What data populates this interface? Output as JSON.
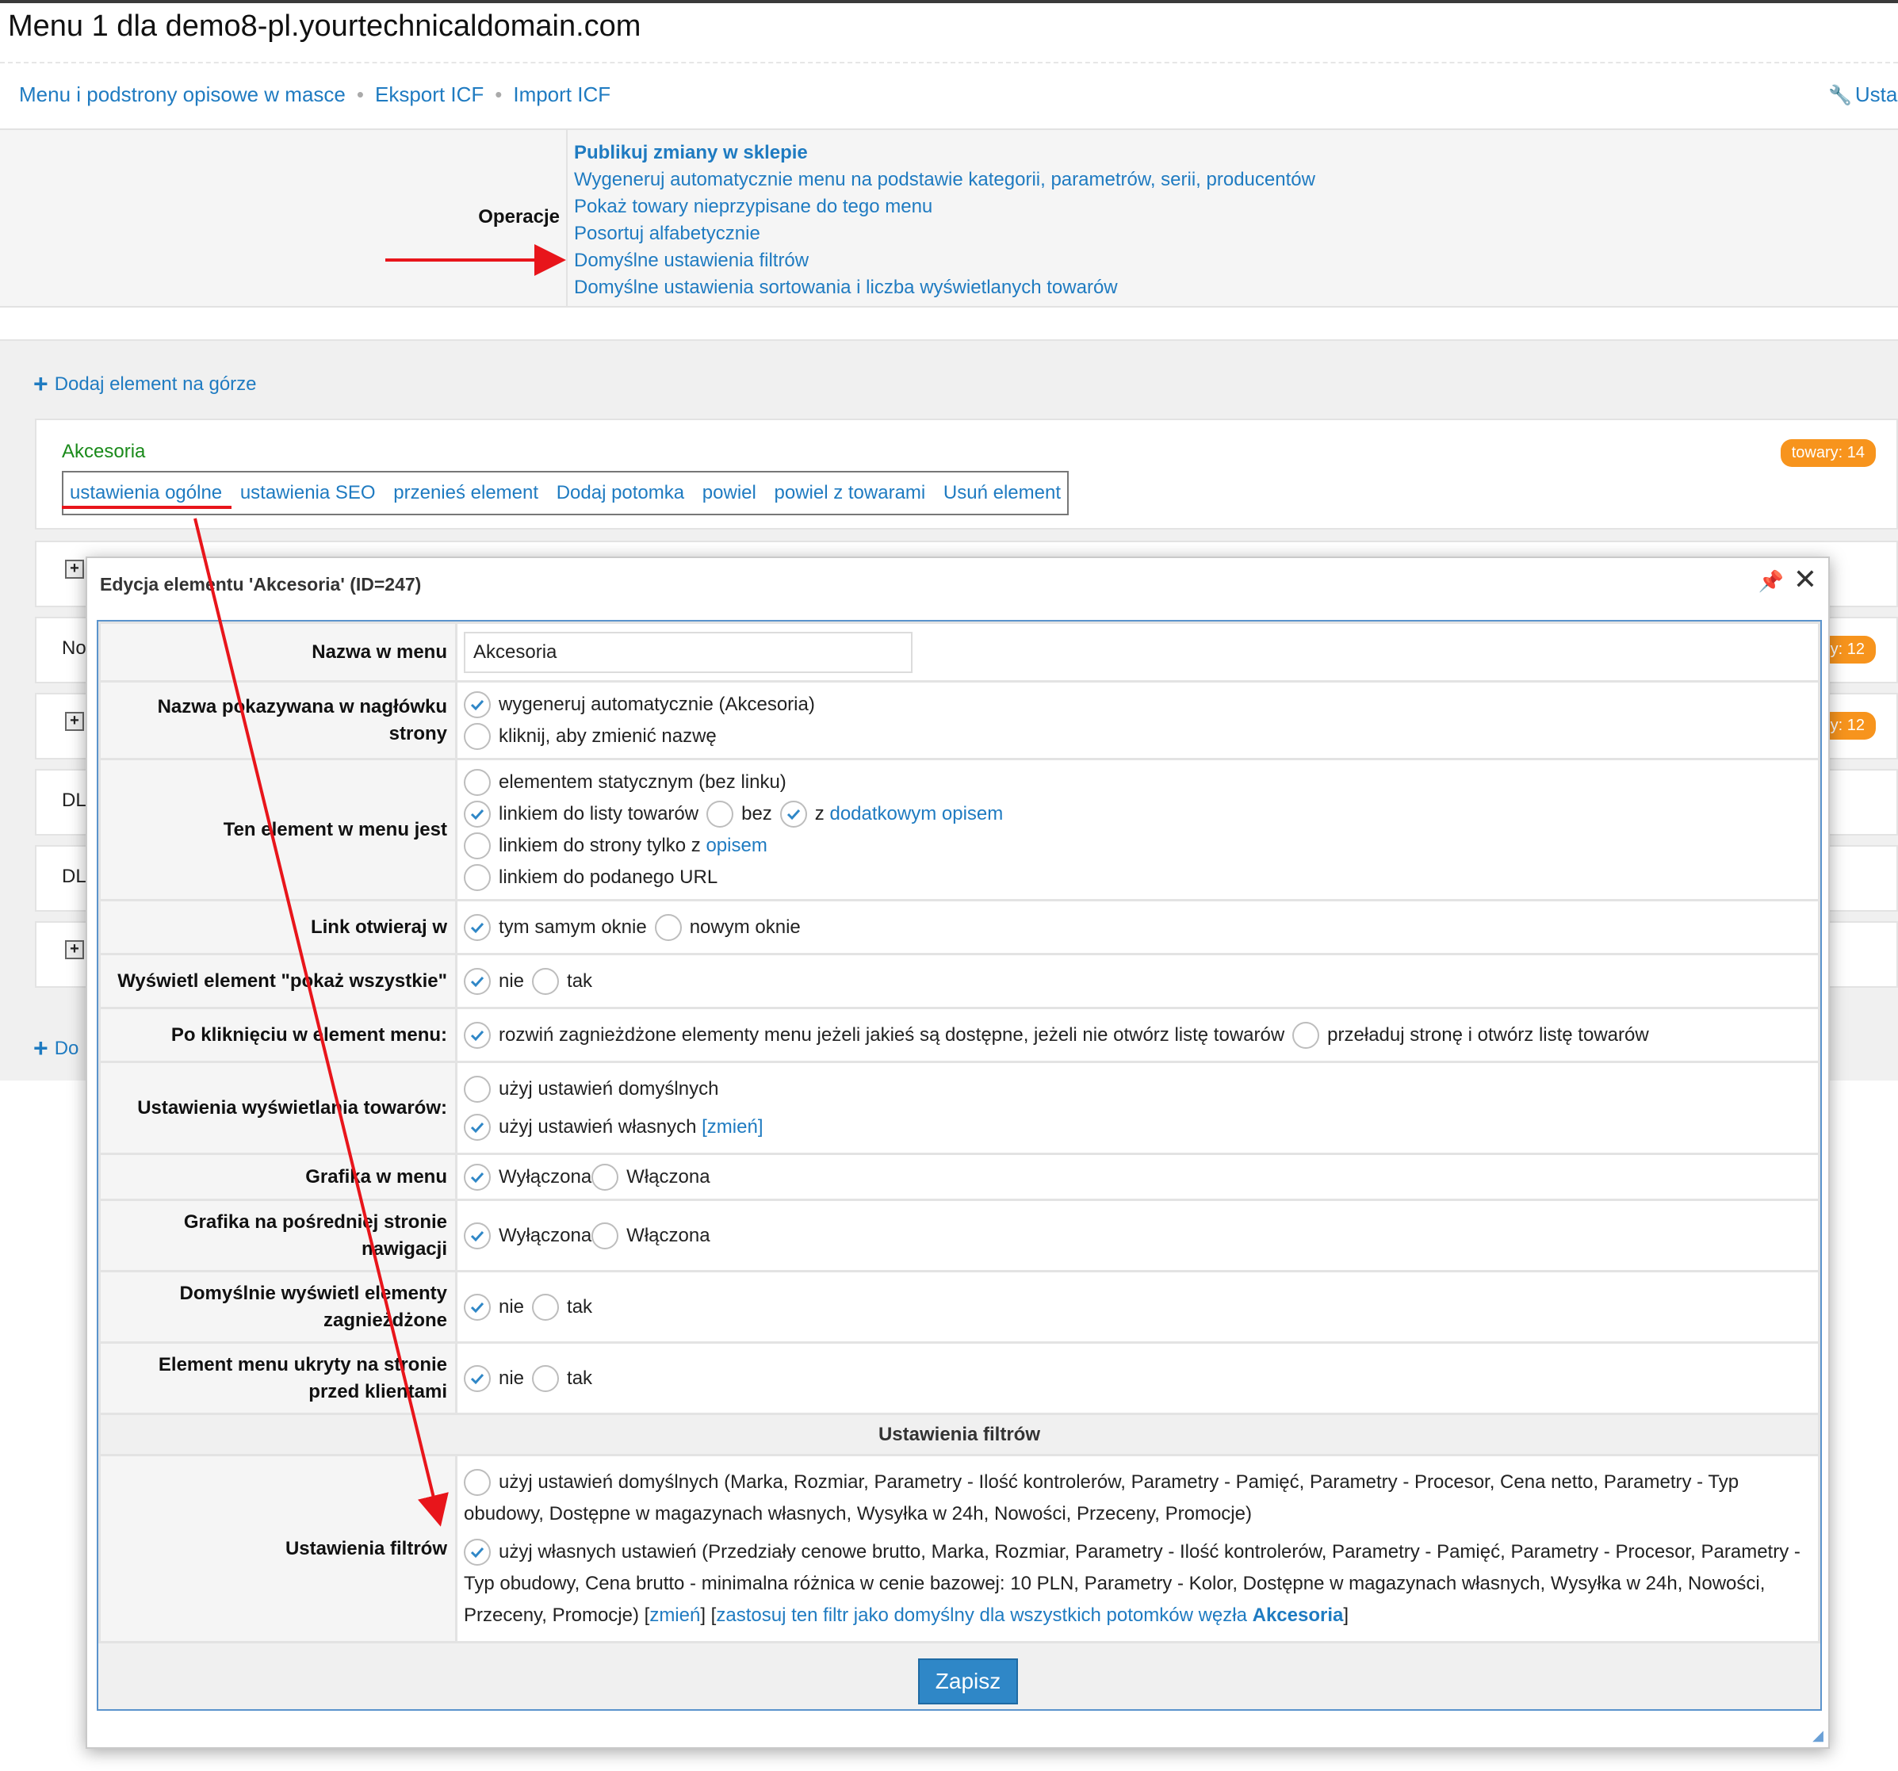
{
  "page": {
    "title": "Menu 1 dla demo8-pl.yourtechnicaldomain.com",
    "nav": [
      "Menu i podstrony opisowe w masce",
      "Eksport ICF",
      "Import ICF"
    ],
    "settings_link": "Usta"
  },
  "operations": {
    "label": "Operacje",
    "items": [
      "Publikuj zmiany w sklepie",
      "Wygeneruj automatycznie menu na podstawie kategorii, parametrów, serii, producentów",
      "Pokaż towary nieprzypisane do tego menu",
      "Posortuj alfabetycznie",
      "Domyślne ustawienia filtrów",
      "Domyślne ustawienia sortowania i liczba wyświetlanych towarów"
    ]
  },
  "add_top": "Dodaj element na górze",
  "add_bottom": "Do",
  "item": {
    "name": "Akcesoria",
    "badge": "towary: 14",
    "actions": [
      "ustawienia ogólne",
      "ustawienia SEO",
      "przenieś element",
      "Dodaj potomka",
      "powiel",
      "powiel z towarami",
      "Usuń element"
    ]
  },
  "background_rows": {
    "row2_text": "No",
    "row2_badge": "y: 12",
    "row3_badge": "y: 12",
    "row4_text": "DL",
    "row5_text": "DL"
  },
  "modal": {
    "title": "Edycja elementu 'Akcesoria' (ID=247)",
    "rows": {
      "name_label": "Nazwa w menu",
      "name_value": "Akcesoria",
      "header_label": "Nazwa pokazywana w nagłówku strony",
      "header_opt1": "wygeneruj automatycznie (Akcesoria)",
      "header_opt2": "kliknij, aby zmienić nazwę",
      "type_label": "Ten element w menu jest",
      "type_opt1": "elementem statycznym (bez linku)",
      "type_opt2": "linkiem do listy towarów",
      "type_opt2_bez": "bez",
      "type_opt2_z": "z",
      "type_opt2_link": "dodatkowym opisem",
      "type_opt3": "linkiem do strony tylko z",
      "type_opt3_link": "opisem",
      "type_opt4": "linkiem do podanego URL",
      "open_label": "Link otwieraj w",
      "open_opt1": "tym samym oknie",
      "open_opt2": "nowym oknie",
      "showall_label": "Wyświetl element \"pokaż wszystkie\"",
      "showall_opt1": "nie",
      "showall_opt2": "tak",
      "click_label": "Po kliknięciu w element menu:",
      "click_opt1": "rozwiń zagnieżdżone elementy menu jeżeli jakieś są dostępne, jeżeli nie otwórz listę towarów",
      "click_opt2": "przeładuj stronę i otwórz listę towarów",
      "display_label": "Ustawienia wyświetlania towarów:",
      "display_opt1": "użyj ustawień domyślnych",
      "display_opt2": "użyj ustawień własnych",
      "display_change": "[zmień]",
      "gfx_label": "Grafika w menu",
      "gfx_opt1": "Wyłączona",
      "gfx_opt2": "Włączona",
      "gfx2_label": "Grafika na pośredniej stronie nawigacji",
      "gfx2_opt1": "Wyłączona",
      "gfx2_opt2": "Włączona",
      "nested_label": "Domyślnie wyświetl elementy zagnieżdżone",
      "nested_opt1": "nie",
      "nested_opt2": "tak",
      "hidden_label": "Element menu ukryty na stronie przed klientami",
      "hidden_opt1": "nie",
      "hidden_opt2": "tak",
      "section_title": "Ustawienia filtrów",
      "filters_label": "Ustawienia filtrów",
      "filters_opt1": "użyj ustawień domyślnych (Marka, Rozmiar, Parametry - Ilość kontrolerów, Parametry - Pamięć, Parametry - Procesor, Cena netto, Parametry - Typ obudowy, Dostępne w magazynach własnych, Wysyłka w 24h, Nowości, Przeceny, Promocje)",
      "filters_opt2": "użyj własnych ustawień (Przedziały cenowe brutto, Marka, Rozmiar, Parametry - Ilość kontrolerów, Parametry - Pamięć, Parametry - Procesor, Parametry - Typ obudowy, Cena brutto - minimalna różnica w cenie bazowej: 10 PLN, Parametry - Kolor, Dostępne w magazynach własnych, Wysyłka w 24h, Nowości, Przeceny, Promocje)",
      "filters_change": "zmień",
      "filters_apply": "zastosuj ten filtr jako domyślny dla wszystkich potomków węzła",
      "filters_apply_node": "Akcesoria"
    },
    "save_label": "Zapisz"
  },
  "colors": {
    "link": "#1f7bc1",
    "badge": "#f7941d",
    "item_name": "#1a8a1a",
    "annotation": "#e8151b",
    "button": "#2f87c7"
  }
}
